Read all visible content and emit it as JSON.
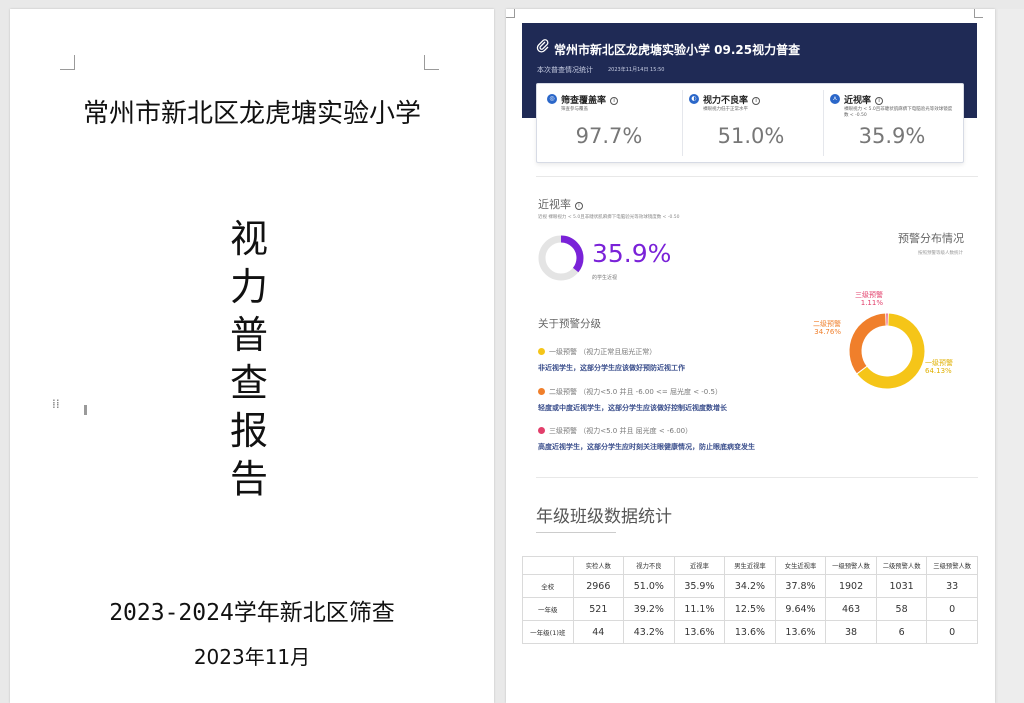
{
  "cover": {
    "school": "常州市新北区龙虎塘实验小学",
    "title_chars": [
      "视",
      "力",
      "普",
      "查",
      "报",
      "告"
    ],
    "year_line": "2023-2024学年新北区筛查",
    "date": "2023年11月"
  },
  "report": {
    "banner_title": "常州市新北区龙虎塘实验小学 09.25视力普查",
    "banner_subtitle": "本次普查情况统计",
    "banner_time": "2023年11月14日 15:50",
    "stats": [
      {
        "icon": "screen-coverage-icon",
        "label": "筛查覆盖率",
        "desc": "筛查参与覆盖",
        "value": "97.7%",
        "color": "#2b67c9"
      },
      {
        "icon": "poor-vision-icon",
        "label": "视力不良率",
        "desc": "裸眼视力低于正常水平",
        "value": "51.0%",
        "color": "#2b67c9"
      },
      {
        "icon": "myopia-icon",
        "label": "近视率",
        "desc": "裸眼视力 < 5.0且非睫状肌麻痹下电脑验光等效球镜度数 < -0.50",
        "value": "35.9%",
        "color": "#2b67c9"
      }
    ],
    "myopia": {
      "title": "近视率",
      "desc": "近视   裸眼视力 < 5.0且非睫状肌麻痹下电脑验光等效球镜度数 < -0.50",
      "value": "35.9%",
      "fraction": 0.359,
      "sub": "的学生近视",
      "color": "#7a22d8"
    },
    "warning_dist": {
      "title": "预警分布情况",
      "sub": "按照预警等级人数统计"
    },
    "about": {
      "title": "关于预警分级",
      "levels": [
        {
          "head": "一级预警 （视力正常且屈光正常）",
          "desc": "非近视学生，这部分学生应该做好预防近视工作",
          "color": "#f5c518"
        },
        {
          "head": "二级预警 （视力<5.0 并且 -6.00 <= 屈光度 < -0.5）",
          "desc": "轻度或中度近视学生，这部分学生应该做好控制近视度数增长",
          "color": "#f07f2b"
        },
        {
          "head": "三级预警 （视力<5.0 并且 屈光度 < -6.00）",
          "desc": "高度近视学生，这部分学生应时刻关注眼健康情况，防止眼底病变发生",
          "color": "#e23f6b"
        }
      ]
    },
    "chart_data": {
      "type": "pie",
      "categories": [
        "一级预警",
        "二级预警",
        "三级预警"
      ],
      "values": [
        64.13,
        34.76,
        1.11
      ],
      "labels": [
        "64.13%",
        "34.76%",
        "1.11%"
      ],
      "colors": [
        "#f5c518",
        "#f07f2b",
        "#e23f6b"
      ],
      "title": ""
    },
    "grade_section_title": "年级班级数据统计",
    "table": {
      "headers": [
        "",
        "实检人数",
        "视力不良",
        "近视率",
        "男生近视率",
        "女生近视率",
        "一级预警人数",
        "二级预警人数",
        "三级预警人数"
      ],
      "rows": [
        [
          "全校",
          "2966",
          "51.0%",
          "35.9%",
          "34.2%",
          "37.8%",
          "1902",
          "1031",
          "33"
        ],
        [
          "一年级",
          "521",
          "39.2%",
          "11.1%",
          "12.5%",
          "9.64%",
          "463",
          "58",
          "0"
        ],
        [
          "一年级(1)班",
          "44",
          "43.2%",
          "13.6%",
          "13.6%",
          "13.6%",
          "38",
          "6",
          "0"
        ]
      ]
    }
  }
}
